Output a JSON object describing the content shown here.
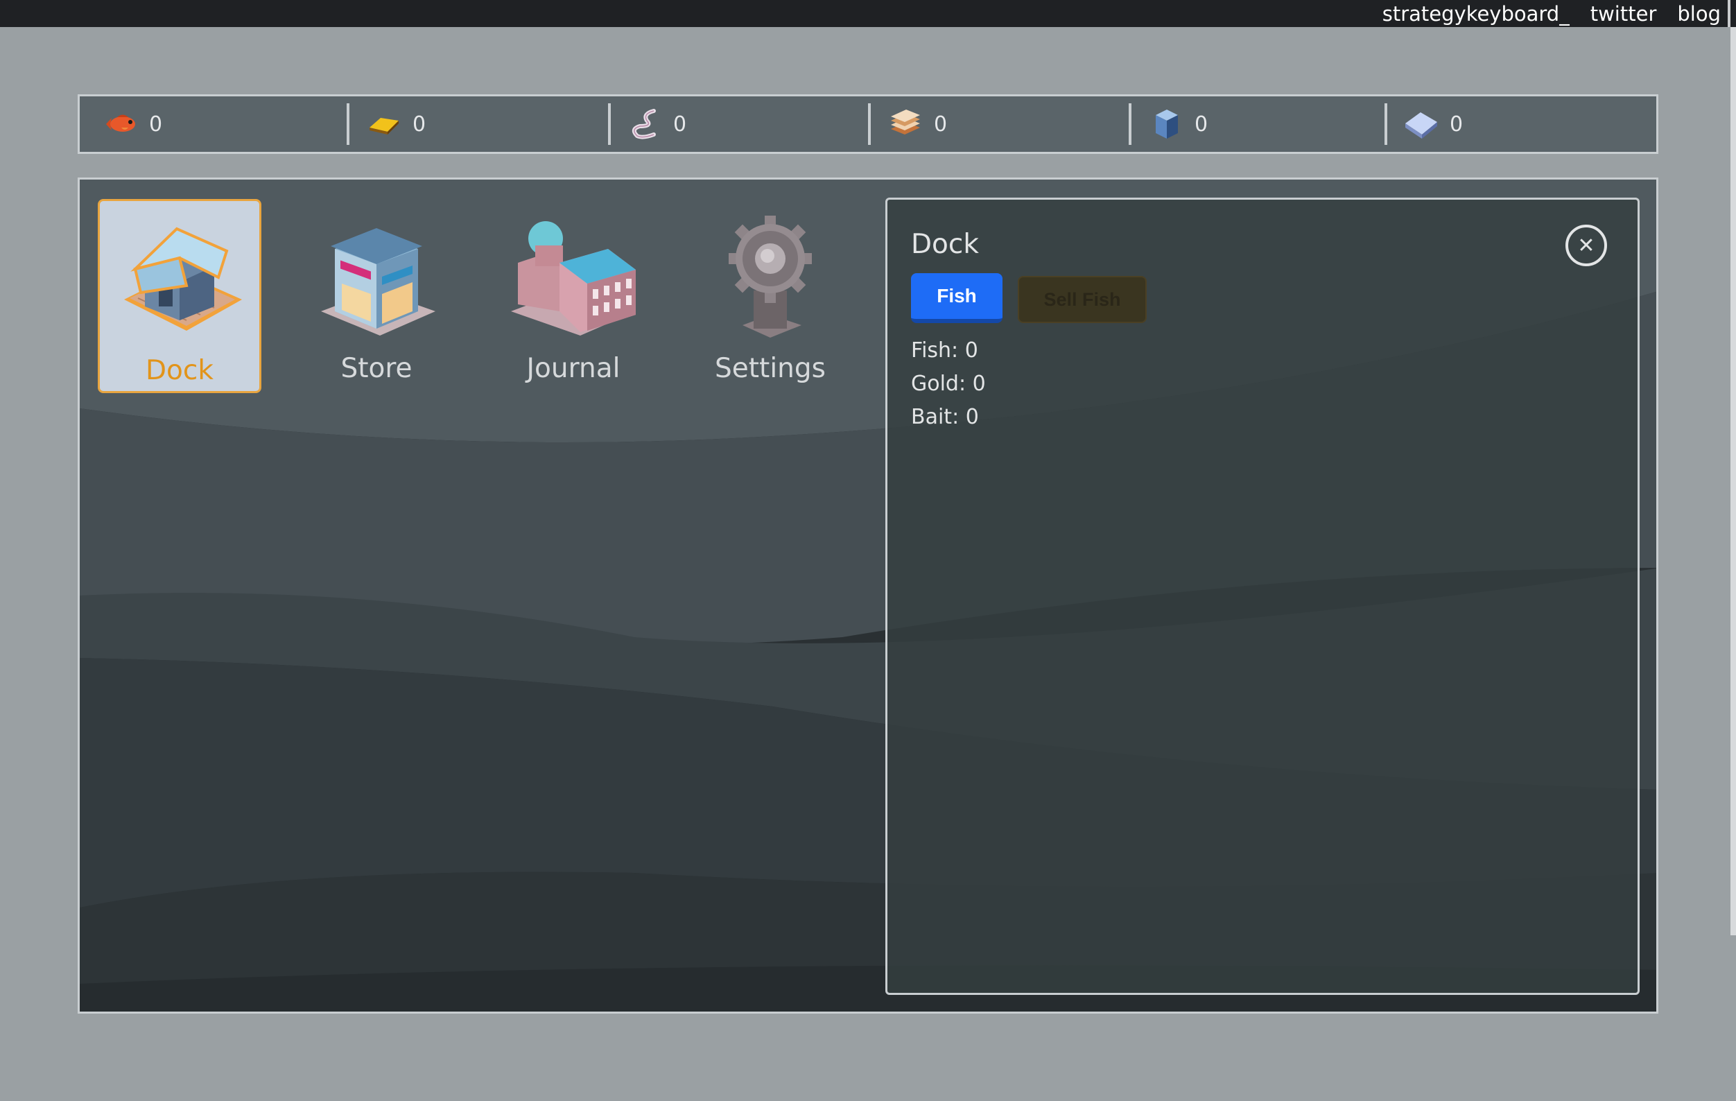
{
  "topbar": {
    "links": [
      "strategykeyboard_",
      "twitter",
      "blog"
    ]
  },
  "resources": [
    {
      "icon": "fish-icon",
      "value": "0"
    },
    {
      "icon": "gold-bar-icon",
      "value": "0"
    },
    {
      "icon": "worm-bait-icon",
      "value": "0"
    },
    {
      "icon": "wood-planks-icon",
      "value": "0"
    },
    {
      "icon": "blue-cube-icon",
      "value": "0"
    },
    {
      "icon": "crystal-icon",
      "value": "0"
    }
  ],
  "nav": {
    "items": [
      {
        "label": "Dock",
        "icon": "dock-building-icon",
        "active": true
      },
      {
        "label": "Store",
        "icon": "store-building-icon",
        "active": false
      },
      {
        "label": "Journal",
        "icon": "journal-building-icon",
        "active": false
      },
      {
        "label": "Settings",
        "icon": "settings-gear-icon",
        "active": false
      }
    ]
  },
  "panel": {
    "title": "Dock",
    "close_icon": "close-icon",
    "fish_button": "Fish",
    "sell_button": "Sell Fish",
    "stats": [
      "Fish: 0",
      "Gold: 0",
      "Bait: 0"
    ]
  },
  "colors": {
    "accent_active": "#e2941a",
    "fish_button": "#1e6cf6",
    "panel_border": "#c9ced1"
  }
}
